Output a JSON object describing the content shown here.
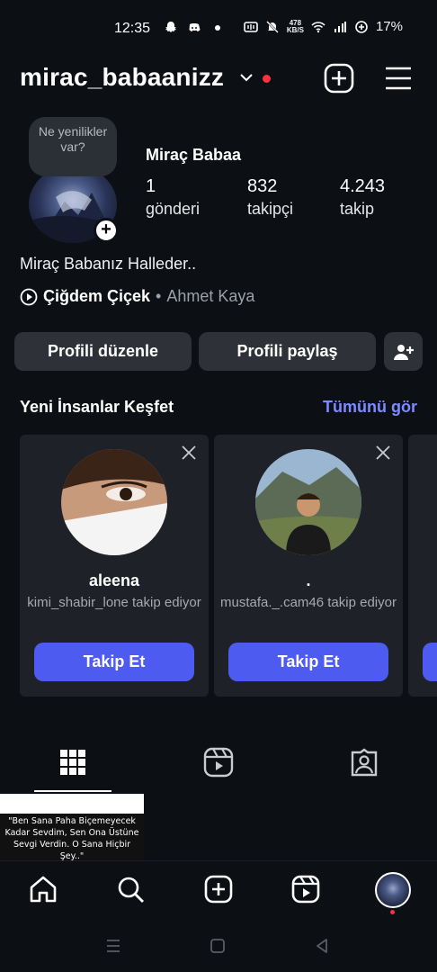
{
  "status_bar": {
    "time": "12:35",
    "speed_top": "478",
    "speed_bottom": "KB/S",
    "battery": "17%"
  },
  "header": {
    "username": "mirac_babaanizz",
    "notification_dot_color": "#ff3040"
  },
  "profile": {
    "note": "Ne yenilikler var?",
    "full_name": "Miraç Babaa",
    "stats": [
      {
        "value": "1",
        "label": "gönderi"
      },
      {
        "value": "832",
        "label": "takipçi"
      },
      {
        "value": "4.243",
        "label": "takip"
      }
    ],
    "bio": "Miraç Babanız Halleder..",
    "music": {
      "song": "Çiğdem Çiçek",
      "separator": "•",
      "artist": "Ahmet Kaya"
    }
  },
  "actions": {
    "edit_profile": "Profili düzenle",
    "share_profile": "Profili paylaş"
  },
  "discover": {
    "title": "Yeni İnsanlar Keşfet",
    "see_all": "Tümünü gör",
    "cards": [
      {
        "name": "aleena",
        "subtitle": "kimi_shabir_lone takip ediyor",
        "button": "Takip Et"
      },
      {
        "name": ".",
        "subtitle": "mustafa._.cam46 takip ediyor",
        "button": "Takip Et"
      }
    ],
    "accent_color": "#4e5bf0"
  },
  "post": {
    "caption": "\"Ben Sana Paha Biçemeyecek Kadar Sevdim, Sen Ona Üstüne Sevgi Verdin. O Sana Hiçbir Şey..\""
  }
}
